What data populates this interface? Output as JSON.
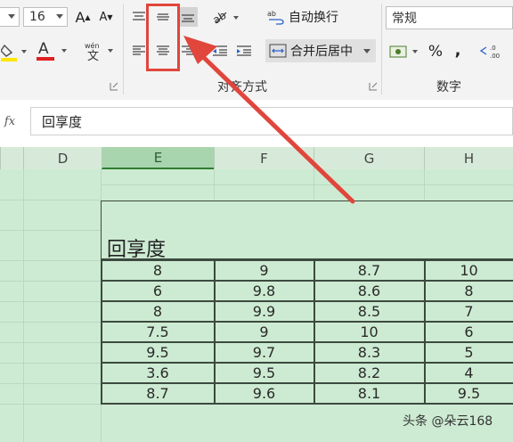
{
  "ribbon": {
    "font_size": "16",
    "grow_font_label": "A",
    "shrink_font_label": "A",
    "wrap_text_label": "自动换行",
    "merge_center_label": "合并后居中",
    "alignment_group_label": "对齐方式",
    "number_format_value": "常规",
    "percent_label": "%",
    "comma_label": ",",
    "number_group_label": "数字",
    "phonetic_label": "文"
  },
  "formula_bar": {
    "fx_label": "fx",
    "value": "回享度"
  },
  "columns": [
    {
      "name": "D",
      "selected": false
    },
    {
      "name": "E",
      "selected": true
    },
    {
      "name": "F",
      "selected": false
    },
    {
      "name": "G",
      "selected": false
    },
    {
      "name": "H",
      "selected": false
    }
  ],
  "sheet": {
    "merged_title": "回享度",
    "rows": [
      [
        "8",
        "9",
        "8.7",
        "10"
      ],
      [
        "6",
        "9.8",
        "8.6",
        "8"
      ],
      [
        "8",
        "9.9",
        "8.5",
        "7"
      ],
      [
        "7.5",
        "9",
        "10",
        "6"
      ],
      [
        "9.5",
        "9.7",
        "8.3",
        "5"
      ],
      [
        "3.6",
        "9.5",
        "8.2",
        "4"
      ],
      [
        "8.7",
        "9.6",
        "8.1",
        "9.5"
      ]
    ]
  },
  "annotation": {
    "highlight_color": "#e0463c",
    "arrow_color": "#e0463c"
  },
  "watermark": "头条 @朵云168",
  "colors": {
    "grid_background": "#cdebd2",
    "selected_column": "#a9d5ae",
    "ribbon_background": "#f3f3f3"
  }
}
